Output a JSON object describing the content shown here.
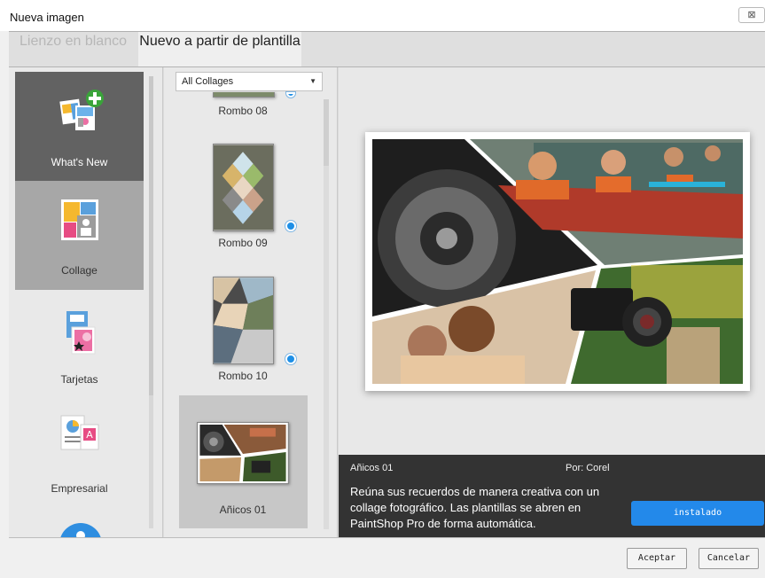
{
  "window": {
    "title": "Nueva imagen",
    "close_glyph": "⊠"
  },
  "tabs": [
    {
      "label": "Lienzo en blanco",
      "active": false
    },
    {
      "label": "Nuevo a partir de plantilla",
      "active": true
    }
  ],
  "categories": [
    {
      "label": "What's New",
      "icon": "whats-new-icon"
    },
    {
      "label": "Collage",
      "icon": "collage-icon"
    },
    {
      "label": "Tarjetas",
      "icon": "cards-icon"
    },
    {
      "label": "Empresarial",
      "icon": "business-icon"
    }
  ],
  "filter": {
    "selected": "All Collages",
    "caret": "▼"
  },
  "templates": [
    {
      "label": "Rombo 08"
    },
    {
      "label": "Rombo 09"
    },
    {
      "label": "Rombo 10"
    },
    {
      "label": "Añicos 01"
    }
  ],
  "details": {
    "name": "Añicos 01",
    "author": "Por: Corel",
    "description": "Reúna sus recuerdos de manera creativa con un collage fotográfico. Las plantillas se abren en PaintShop Pro de forma automática.",
    "install_label": "instalado"
  },
  "footer": {
    "accept_label": "Aceptar",
    "cancel_label": "Cancelar"
  },
  "colors": {
    "accent": "#2389ea",
    "info_bg": "#333333",
    "selected_category": "#626262"
  }
}
